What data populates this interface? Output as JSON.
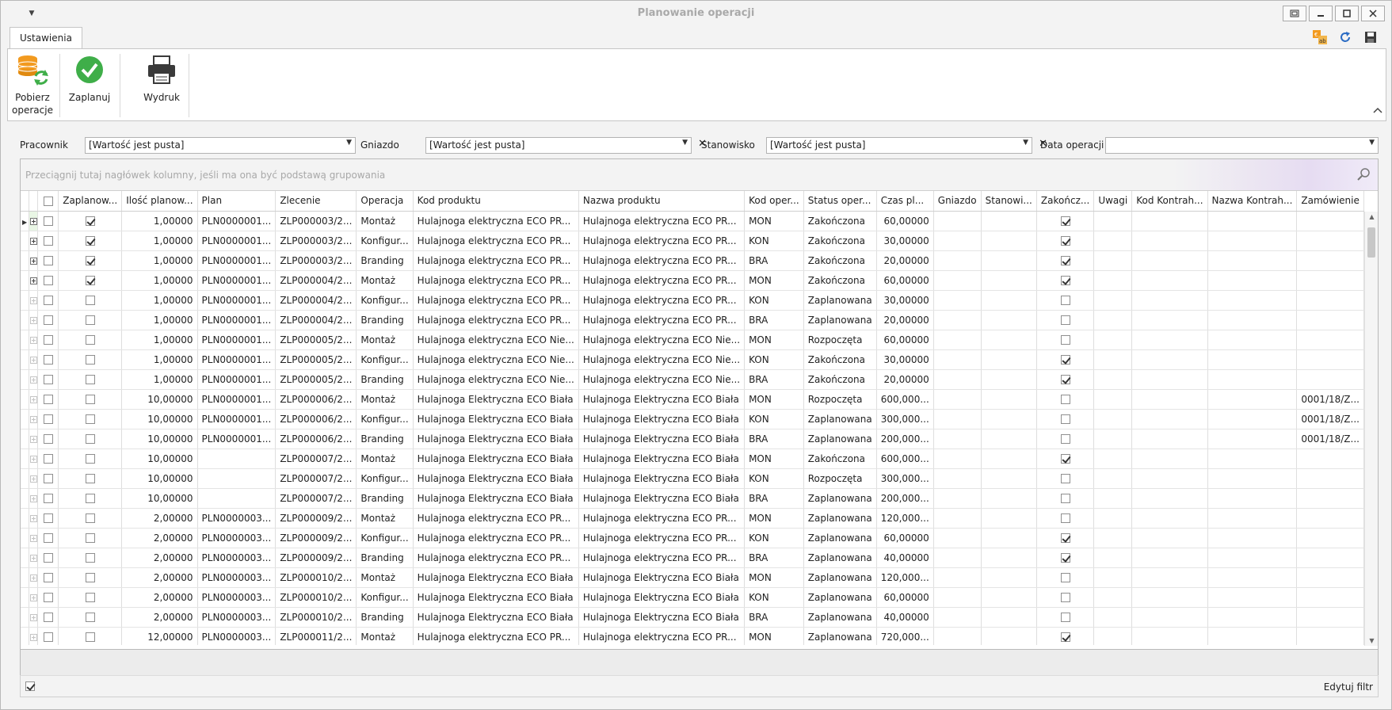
{
  "window": {
    "title": "Planowanie operacji"
  },
  "tabs": [
    {
      "label": "Ustawienia"
    }
  ],
  "ribbon": {
    "buttons": [
      {
        "label_line1": "Pobierz",
        "label_line2": "operacje"
      },
      {
        "label_line1": "Zaplanuj",
        "label_line2": ""
      },
      {
        "label_line1": "Wydruk",
        "label_line2": ""
      }
    ]
  },
  "filters": {
    "pracownik": {
      "label": "Pracownik",
      "value": "[Wartość jest pusta]"
    },
    "gniazdo": {
      "label": "Gniazdo",
      "value": "[Wartość jest pusta]"
    },
    "stanowisko": {
      "label": "Stanowisko",
      "value": "[Wartość jest pusta]"
    },
    "data": {
      "label": "Data operacji",
      "value": ""
    }
  },
  "grid": {
    "group_hint": "Przeciągnij tutaj nagłówek kolumny, jeśli ma ona być podstawą grupowania",
    "columns": [
      "Zaplanow...",
      "Ilość planow...",
      "Plan",
      "Zlecenie",
      "Operacja",
      "Kod produktu",
      "Nazwa produktu",
      "Kod oper...",
      "Status oper...",
      "Czas pl...",
      "Gniazdo",
      "Stanowi...",
      "Zakończ...",
      "Uwagi",
      "Kod Kontrah...",
      "Nazwa Kontrah...",
      "Zamówienie"
    ],
    "rows": [
      {
        "exp": true,
        "sel": false,
        "zap": true,
        "ilosc": "1,00000",
        "plan": "PLN0000001...",
        "zlec": "ZLP000003/2...",
        "oper": "Montaż",
        "kod": "Hulajnoga elektryczna ECO PR...",
        "nazwa": "Hulajnoga elektryczna ECO PR...",
        "kodop": "MON",
        "status": "Zakończona",
        "czas": "60,00000",
        "zak": true,
        "zam": ""
      },
      {
        "exp": true,
        "sel": false,
        "zap": true,
        "ilosc": "1,00000",
        "plan": "PLN0000001...",
        "zlec": "ZLP000003/2...",
        "oper": "Konfigur...",
        "kod": "Hulajnoga elektryczna ECO PR...",
        "nazwa": "Hulajnoga elektryczna ECO PR...",
        "kodop": "KON",
        "status": "Zakończona",
        "czas": "30,00000",
        "zak": true,
        "zam": ""
      },
      {
        "exp": true,
        "sel": false,
        "zap": true,
        "ilosc": "1,00000",
        "plan": "PLN0000001...",
        "zlec": "ZLP000003/2...",
        "oper": "Branding",
        "kod": "Hulajnoga elektryczna ECO PR...",
        "nazwa": "Hulajnoga elektryczna ECO PR...",
        "kodop": "BRA",
        "status": "Zakończona",
        "czas": "20,00000",
        "zak": true,
        "zam": ""
      },
      {
        "exp": true,
        "sel": false,
        "zap": true,
        "ilosc": "1,00000",
        "plan": "PLN0000001...",
        "zlec": "ZLP000004/2...",
        "oper": "Montaż",
        "kod": "Hulajnoga elektryczna ECO PR...",
        "nazwa": "Hulajnoga elektryczna ECO PR...",
        "kodop": "MON",
        "status": "Zakończona",
        "czas": "60,00000",
        "zak": true,
        "zam": ""
      },
      {
        "exp": false,
        "sel": false,
        "zap": false,
        "ilosc": "1,00000",
        "plan": "PLN0000001...",
        "zlec": "ZLP000004/2...",
        "oper": "Konfigur...",
        "kod": "Hulajnoga elektryczna ECO PR...",
        "nazwa": "Hulajnoga elektryczna ECO PR...",
        "kodop": "KON",
        "status": "Zaplanowana",
        "czas": "30,00000",
        "zak": false,
        "zam": ""
      },
      {
        "exp": false,
        "sel": false,
        "zap": false,
        "ilosc": "1,00000",
        "plan": "PLN0000001...",
        "zlec": "ZLP000004/2...",
        "oper": "Branding",
        "kod": "Hulajnoga elektryczna ECO PR...",
        "nazwa": "Hulajnoga elektryczna ECO PR...",
        "kodop": "BRA",
        "status": "Zaplanowana",
        "czas": "20,00000",
        "zak": false,
        "zam": ""
      },
      {
        "exp": false,
        "sel": false,
        "zap": false,
        "ilosc": "1,00000",
        "plan": "PLN0000001...",
        "zlec": "ZLP000005/2...",
        "oper": "Montaż",
        "kod": "Hulajnoga elektryczna ECO Nie...",
        "nazwa": "Hulajnoga elektryczna ECO Nie...",
        "kodop": "MON",
        "status": "Rozpoczęta",
        "czas": "60,00000",
        "zak": false,
        "zam": ""
      },
      {
        "exp": false,
        "sel": false,
        "zap": false,
        "ilosc": "1,00000",
        "plan": "PLN0000001...",
        "zlec": "ZLP000005/2...",
        "oper": "Konfigur...",
        "kod": "Hulajnoga elektryczna ECO Nie...",
        "nazwa": "Hulajnoga elektryczna ECO Nie...",
        "kodop": "KON",
        "status": "Zakończona",
        "czas": "30,00000",
        "zak": true,
        "zam": ""
      },
      {
        "exp": false,
        "sel": false,
        "zap": false,
        "ilosc": "1,00000",
        "plan": "PLN0000001...",
        "zlec": "ZLP000005/2...",
        "oper": "Branding",
        "kod": "Hulajnoga elektryczna ECO Nie...",
        "nazwa": "Hulajnoga elektryczna ECO Nie...",
        "kodop": "BRA",
        "status": "Zakończona",
        "czas": "20,00000",
        "zak": true,
        "zam": ""
      },
      {
        "exp": false,
        "sel": false,
        "zap": false,
        "ilosc": "10,00000",
        "plan": "PLN0000001...",
        "zlec": "ZLP000006/2...",
        "oper": "Montaż",
        "kod": "Hulajnoga Elektryczna ECO Biała",
        "nazwa": "Hulajnoga Elektryczna ECO Biała",
        "kodop": "MON",
        "status": "Rozpoczęta",
        "czas": "600,000...",
        "zak": false,
        "zam": "0001/18/Z..."
      },
      {
        "exp": false,
        "sel": false,
        "zap": false,
        "ilosc": "10,00000",
        "plan": "PLN0000001...",
        "zlec": "ZLP000006/2...",
        "oper": "Konfigur...",
        "kod": "Hulajnoga Elektryczna ECO Biała",
        "nazwa": "Hulajnoga Elektryczna ECO Biała",
        "kodop": "KON",
        "status": "Zaplanowana",
        "czas": "300,000...",
        "zak": false,
        "zam": "0001/18/Z..."
      },
      {
        "exp": false,
        "sel": false,
        "zap": false,
        "ilosc": "10,00000",
        "plan": "PLN0000001...",
        "zlec": "ZLP000006/2...",
        "oper": "Branding",
        "kod": "Hulajnoga Elektryczna ECO Biała",
        "nazwa": "Hulajnoga Elektryczna ECO Biała",
        "kodop": "BRA",
        "status": "Zaplanowana",
        "czas": "200,000...",
        "zak": false,
        "zam": "0001/18/Z..."
      },
      {
        "exp": false,
        "sel": false,
        "zap": false,
        "ilosc": "10,00000",
        "plan": "",
        "zlec": "ZLP000007/2...",
        "oper": "Montaż",
        "kod": "Hulajnoga Elektryczna ECO Biała",
        "nazwa": "Hulajnoga Elektryczna ECO Biała",
        "kodop": "MON",
        "status": "Zakończona",
        "czas": "600,000...",
        "zak": true,
        "zam": ""
      },
      {
        "exp": false,
        "sel": false,
        "zap": false,
        "ilosc": "10,00000",
        "plan": "",
        "zlec": "ZLP000007/2...",
        "oper": "Konfigur...",
        "kod": "Hulajnoga Elektryczna ECO Biała",
        "nazwa": "Hulajnoga Elektryczna ECO Biała",
        "kodop": "KON",
        "status": "Rozpoczęta",
        "czas": "300,000...",
        "zak": false,
        "zam": ""
      },
      {
        "exp": false,
        "sel": false,
        "zap": false,
        "ilosc": "10,00000",
        "plan": "",
        "zlec": "ZLP000007/2...",
        "oper": "Branding",
        "kod": "Hulajnoga Elektryczna ECO Biała",
        "nazwa": "Hulajnoga Elektryczna ECO Biała",
        "kodop": "BRA",
        "status": "Zaplanowana",
        "czas": "200,000...",
        "zak": false,
        "zam": ""
      },
      {
        "exp": false,
        "sel": false,
        "zap": false,
        "ilosc": "2,00000",
        "plan": "PLN0000003...",
        "zlec": "ZLP000009/2...",
        "oper": "Montaż",
        "kod": "Hulajnoga elektryczna ECO PR...",
        "nazwa": "Hulajnoga elektryczna ECO PR...",
        "kodop": "MON",
        "status": "Zaplanowana",
        "czas": "120,000...",
        "zak": false,
        "zam": ""
      },
      {
        "exp": false,
        "sel": false,
        "zap": false,
        "ilosc": "2,00000",
        "plan": "PLN0000003...",
        "zlec": "ZLP000009/2...",
        "oper": "Konfigur...",
        "kod": "Hulajnoga elektryczna ECO PR...",
        "nazwa": "Hulajnoga elektryczna ECO PR...",
        "kodop": "KON",
        "status": "Zaplanowana",
        "czas": "60,00000",
        "zak": true,
        "zam": ""
      },
      {
        "exp": false,
        "sel": false,
        "zap": false,
        "ilosc": "2,00000",
        "plan": "PLN0000003...",
        "zlec": "ZLP000009/2...",
        "oper": "Branding",
        "kod": "Hulajnoga elektryczna ECO PR...",
        "nazwa": "Hulajnoga elektryczna ECO PR...",
        "kodop": "BRA",
        "status": "Zaplanowana",
        "czas": "40,00000",
        "zak": true,
        "zam": ""
      },
      {
        "exp": false,
        "sel": false,
        "zap": false,
        "ilosc": "2,00000",
        "plan": "PLN0000003...",
        "zlec": "ZLP000010/2...",
        "oper": "Montaż",
        "kod": "Hulajnoga Elektryczna ECO Biała",
        "nazwa": "Hulajnoga Elektryczna ECO Biała",
        "kodop": "MON",
        "status": "Zaplanowana",
        "czas": "120,000...",
        "zak": false,
        "zam": ""
      },
      {
        "exp": false,
        "sel": false,
        "zap": false,
        "ilosc": "2,00000",
        "plan": "PLN0000003...",
        "zlec": "ZLP000010/2...",
        "oper": "Konfigur...",
        "kod": "Hulajnoga Elektryczna ECO Biała",
        "nazwa": "Hulajnoga Elektryczna ECO Biała",
        "kodop": "KON",
        "status": "Zaplanowana",
        "czas": "60,00000",
        "zak": false,
        "zam": ""
      },
      {
        "exp": false,
        "sel": false,
        "zap": false,
        "ilosc": "2,00000",
        "plan": "PLN0000003...",
        "zlec": "ZLP000010/2...",
        "oper": "Branding",
        "kod": "Hulajnoga Elektryczna ECO Biała",
        "nazwa": "Hulajnoga Elektryczna ECO Biała",
        "kodop": "BRA",
        "status": "Zaplanowana",
        "czas": "40,00000",
        "zak": false,
        "zam": ""
      },
      {
        "exp": false,
        "sel": false,
        "zap": false,
        "ilosc": "12,00000",
        "plan": "PLN0000003...",
        "zlec": "ZLP000011/2...",
        "oper": "Montaż",
        "kod": "Hulajnoga elektryczna ECO PR...",
        "nazwa": "Hulajnoga elektryczna ECO PR...",
        "kodop": "MON",
        "status": "Zaplanowana",
        "czas": "720,000...",
        "zak": true,
        "zam": ""
      }
    ]
  },
  "statusbar": {
    "edit_filter": "Edytuj filtr"
  },
  "colors": {
    "accent_green": "#3fae49",
    "db_orange": "#f29a1f",
    "refresh_blue": "#2b6cc4"
  },
  "icons": [
    "menu-caret-icon",
    "restore-icon",
    "minimize-icon",
    "maximize-icon",
    "close-icon",
    "translate-icon",
    "refresh-icon",
    "save-icon",
    "database-sync-icon",
    "check-circle-icon",
    "printer-icon",
    "collapse-ribbon-icon",
    "search-icon"
  ]
}
